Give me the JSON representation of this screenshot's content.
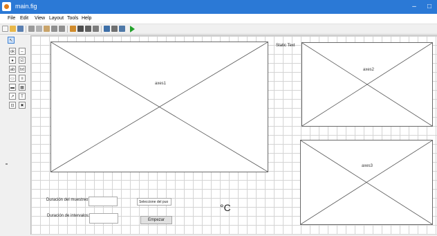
{
  "window": {
    "title": "main.fig",
    "minimize_glyph": "–",
    "maximize_glyph": "□"
  },
  "menu": [
    "File",
    "Edit",
    "View",
    "Layout",
    "Tools",
    "Help"
  ],
  "toolbar_icons": [
    "new-icon",
    "open-icon",
    "save-icon",
    "cut-icon",
    "copy-icon",
    "paste-icon",
    "undo-icon",
    "redo-icon",
    "align-icon",
    "menu-editor-icon",
    "tab-order-icon",
    "toolbar-editor-icon",
    "mfile-editor-icon",
    "property-inspector-icon",
    "object-browser-icon",
    "run-icon"
  ],
  "palette_icons": [
    "select-arrow-icon",
    "push-button-icon",
    "slider-icon",
    "radio-button-icon",
    "checkbox-icon",
    "edit-text-icon",
    "static-text-icon",
    "popup-menu-icon",
    "listbox-icon",
    "toggle-button-icon",
    "table-icon",
    "axes-icon",
    "panel-icon",
    "button-group-icon",
    "activex-icon"
  ],
  "axes": {
    "a1": "axes1",
    "a2": "axes2",
    "a3": "axes3"
  },
  "static_text": "Static Text",
  "labels": {
    "muestreo": "Duración del muestreo:",
    "intervalos": "Duración de intervalos:"
  },
  "popup": {
    "selected": "Seleccione del puo"
  },
  "start_button": "Empezar",
  "unit": "°C",
  "colors": {
    "titlebar": "#2b79d6",
    "run_icon": "#22a12a"
  }
}
